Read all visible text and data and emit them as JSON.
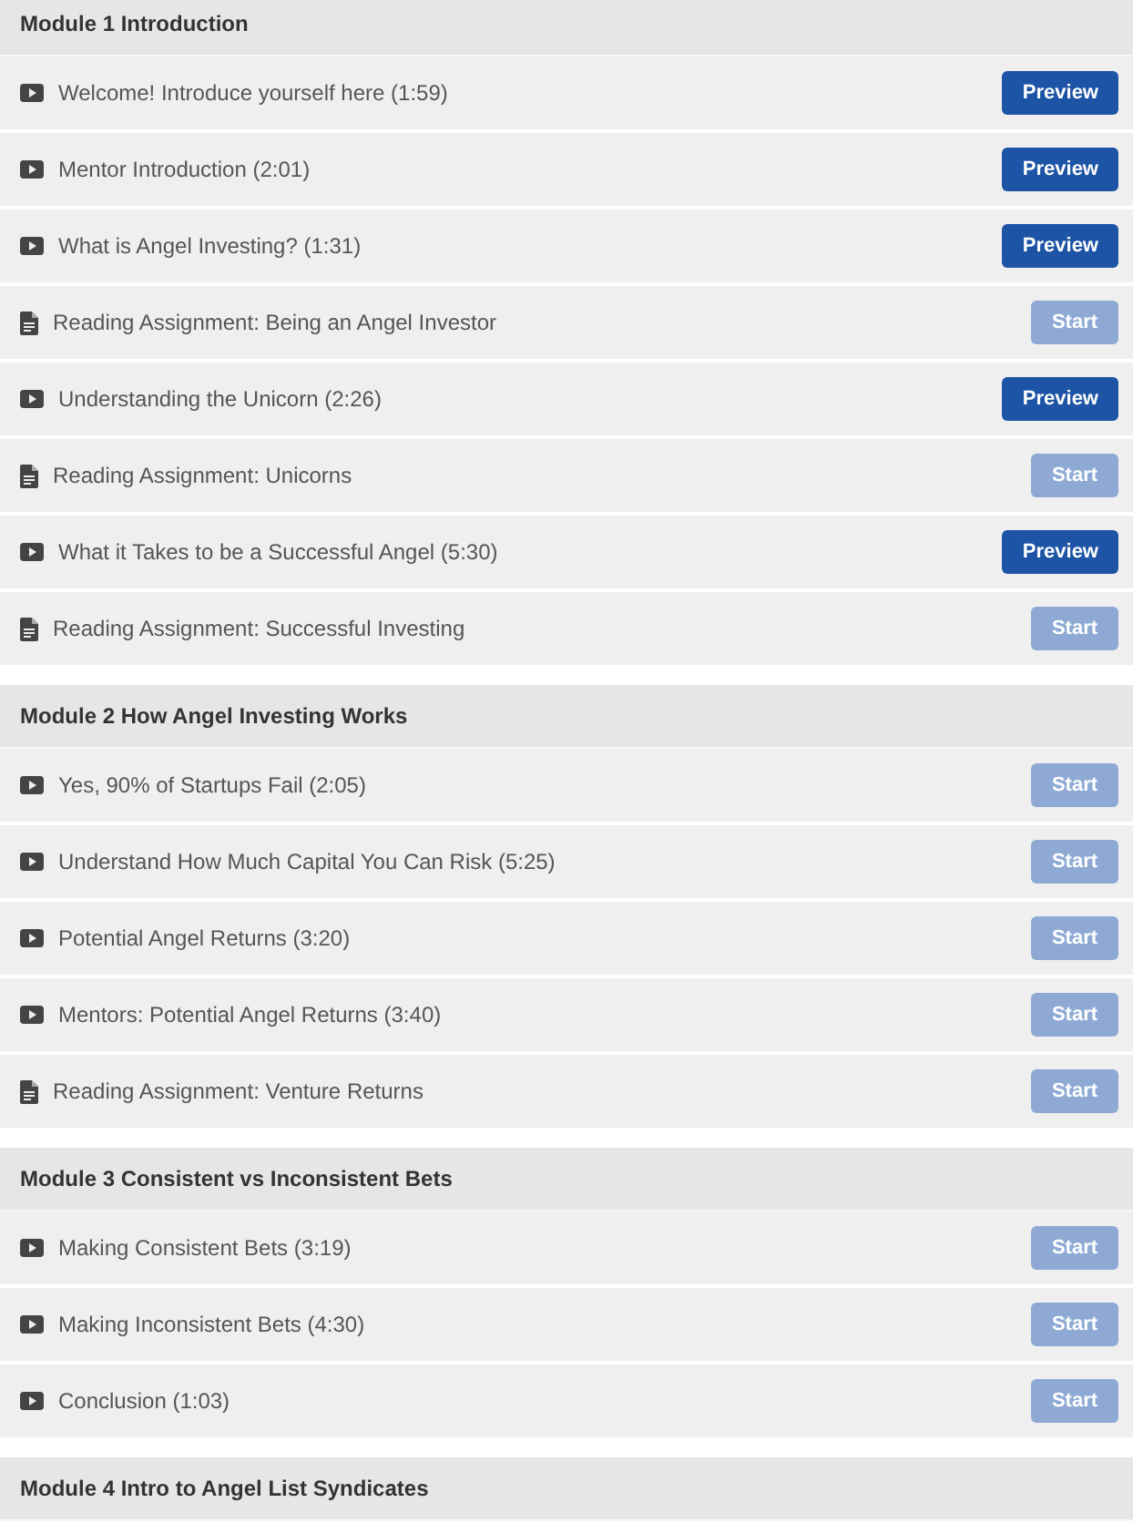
{
  "modules": [
    {
      "title": "Module 1 Introduction",
      "lessons": [
        {
          "kind": "video",
          "title": "Welcome! Introduce yourself here (1:59)",
          "button": {
            "label": "Preview",
            "disabled": false
          }
        },
        {
          "kind": "video",
          "title": "Mentor Introduction (2:01)",
          "button": {
            "label": "Preview",
            "disabled": false
          }
        },
        {
          "kind": "video",
          "title": "What is Angel Investing? (1:31)",
          "button": {
            "label": "Preview",
            "disabled": false
          }
        },
        {
          "kind": "reading",
          "title": "Reading Assignment: Being an Angel Investor",
          "button": {
            "label": "Start",
            "disabled": true
          }
        },
        {
          "kind": "video",
          "title": "Understanding the Unicorn (2:26)",
          "button": {
            "label": "Preview",
            "disabled": false
          }
        },
        {
          "kind": "reading",
          "title": "Reading Assignment: Unicorns",
          "button": {
            "label": "Start",
            "disabled": true
          }
        },
        {
          "kind": "video",
          "title": "What it Takes to be a Successful Angel (5:30)",
          "button": {
            "label": "Preview",
            "disabled": false
          }
        },
        {
          "kind": "reading",
          "title": "Reading Assignment: Successful Investing",
          "button": {
            "label": "Start",
            "disabled": true
          }
        }
      ]
    },
    {
      "title": "Module 2 How Angel Investing Works",
      "lessons": [
        {
          "kind": "video",
          "title": "Yes, 90% of Startups Fail (2:05)",
          "button": {
            "label": "Start",
            "disabled": true
          }
        },
        {
          "kind": "video",
          "title": "Understand How Much Capital You Can Risk (5:25)",
          "button": {
            "label": "Start",
            "disabled": true
          }
        },
        {
          "kind": "video",
          "title": "Potential Angel Returns (3:20)",
          "button": {
            "label": "Start",
            "disabled": true
          }
        },
        {
          "kind": "video",
          "title": "Mentors: Potential Angel Returns (3:40)",
          "button": {
            "label": "Start",
            "disabled": true
          }
        },
        {
          "kind": "reading",
          "title": "Reading Assignment: Venture Returns",
          "button": {
            "label": "Start",
            "disabled": true
          }
        }
      ]
    },
    {
      "title": "Module 3 Consistent vs Inconsistent Bets",
      "lessons": [
        {
          "kind": "video",
          "title": "Making Consistent Bets (3:19)",
          "button": {
            "label": "Start",
            "disabled": true
          }
        },
        {
          "kind": "video",
          "title": "Making Inconsistent Bets (4:30)",
          "button": {
            "label": "Start",
            "disabled": true
          }
        },
        {
          "kind": "video",
          "title": "Conclusion (1:03)",
          "button": {
            "label": "Start",
            "disabled": true
          }
        }
      ]
    },
    {
      "title": "Module 4 Intro to Angel List Syndicates"
    }
  ]
}
